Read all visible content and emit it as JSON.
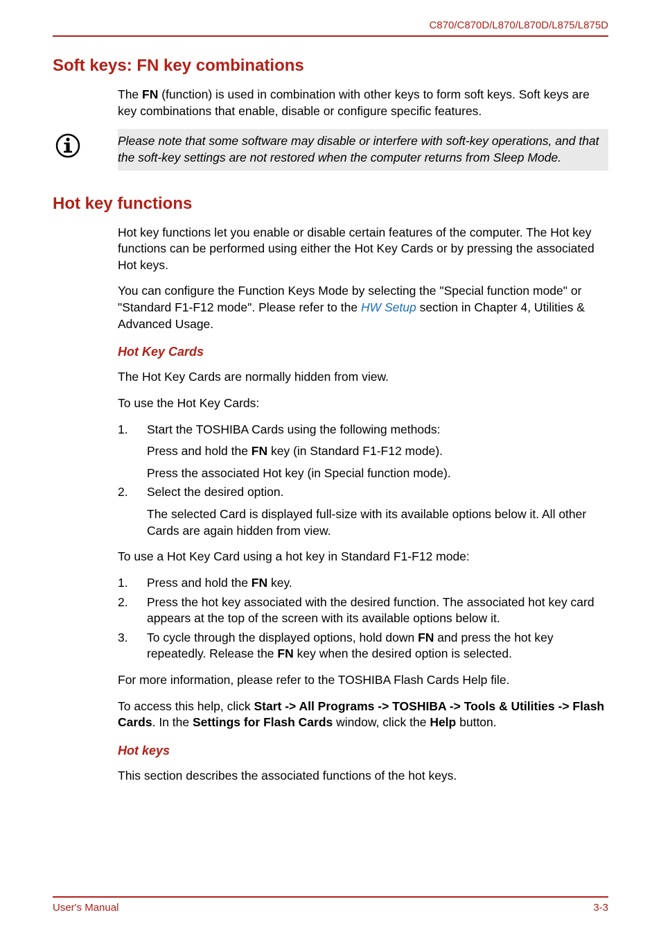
{
  "header": {
    "model_line": "C870/C870D/L870/L870D/L875/L875D"
  },
  "section1": {
    "title": "Soft keys: FN key combinations",
    "p1_a": "The ",
    "p1_b": "FN",
    "p1_c": " (function) is used in combination with other keys to form soft keys. Soft keys are key combinations that enable, disable or configure specific features.",
    "note": "Please note that some software may disable or interfere with soft-key operations, and that the soft-key settings are not restored when the computer returns from Sleep Mode."
  },
  "section2": {
    "title": "Hot key functions",
    "p1": "Hot key functions let you enable or disable certain features of the computer. The Hot key functions can be performed using either the Hot Key Cards or by pressing the associated Hot keys.",
    "p2_a": "You can configure the Function Keys Mode by selecting the \"Special function mode\" or \"Standard F1-F12 mode\". Please refer to the ",
    "p2_link": "HW Setup",
    "p2_b": " section in Chapter 4, Utilities & Advanced Usage.",
    "sub1": {
      "title": "Hot Key Cards",
      "p1": "The Hot Key Cards are normally hidden from view.",
      "p2": "To use the Hot Key Cards:",
      "list1": [
        {
          "n": "1.",
          "line1": "Start the TOSHIBA Cards using the following methods:",
          "line2_a": "Press and hold the ",
          "line2_b": "FN",
          "line2_c": " key (in Standard F1-F12 mode).",
          "line3": "Press the associated Hot key (in Special function mode)."
        },
        {
          "n": "2.",
          "line1": "Select the desired option.",
          "line2": "The selected Card is displayed full-size with its available options below it. All other Cards are again hidden from view."
        }
      ],
      "p3": "To use a Hot Key Card using a hot key in Standard F1-F12 mode:",
      "list2": [
        {
          "n": "1.",
          "a": "Press and hold the ",
          "b": "FN",
          "c": " key."
        },
        {
          "n": "2.",
          "t": "Press the hot key associated with the desired function. The associated hot key card appears at the top of the screen with its available options below it."
        },
        {
          "n": "3.",
          "a": "To cycle through the displayed options, hold down ",
          "b": "FN",
          "c": " and press the hot key repeatedly. Release the ",
          "d": "FN",
          "e": " key when the desired option is selected."
        }
      ],
      "p4": "For more information, please refer to the TOSHIBA Flash Cards Help file.",
      "p5_a": "To access this help, click ",
      "p5_b": "Start -> All Programs -> TOSHIBA -> Tools & Utilities -> Flash Cards",
      "p5_c": ". In the ",
      "p5_d": "Settings for Flash Cards",
      "p5_e": " window, click the ",
      "p5_f": "Help",
      "p5_g": " button."
    },
    "sub2": {
      "title": "Hot keys",
      "p1": "This section describes the associated functions of the hot keys."
    }
  },
  "footer": {
    "left": "User's Manual",
    "right": "3-3"
  }
}
